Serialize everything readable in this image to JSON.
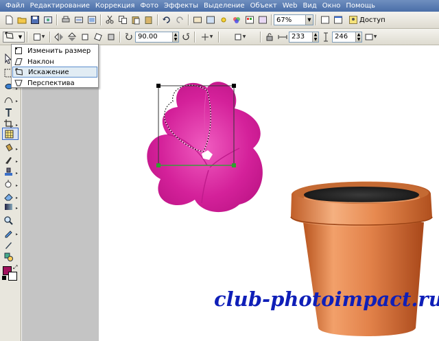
{
  "menu": [
    "Файл",
    "Редактирование",
    "Коррекция",
    "Фото",
    "Эффекты",
    "Выделение",
    "Объект",
    "Web",
    "Вид",
    "Окно",
    "Помощь"
  ],
  "toolbar1": {
    "zoom": "67%",
    "access_label": "Доступ"
  },
  "toolbar2": {
    "rotate_value": "90.00",
    "width_value": "233",
    "height_value": "246"
  },
  "transform_menu": {
    "items": [
      {
        "label": "Изменить размер",
        "icon": "resize-icon"
      },
      {
        "label": "Наклон",
        "icon": "slant-icon"
      },
      {
        "label": "Искажение",
        "icon": "distort-icon",
        "selected": true
      },
      {
        "label": "Перспектива",
        "icon": "perspective-icon"
      }
    ]
  },
  "colors": {
    "foreground": "#a0105c",
    "background": "#ffffff",
    "flower": "#d4219a",
    "pot": "#e2824a",
    "menubar": "#4a6ea8",
    "watermark": "#0f1fb8"
  },
  "watermark": "club-photoimpact.ru"
}
